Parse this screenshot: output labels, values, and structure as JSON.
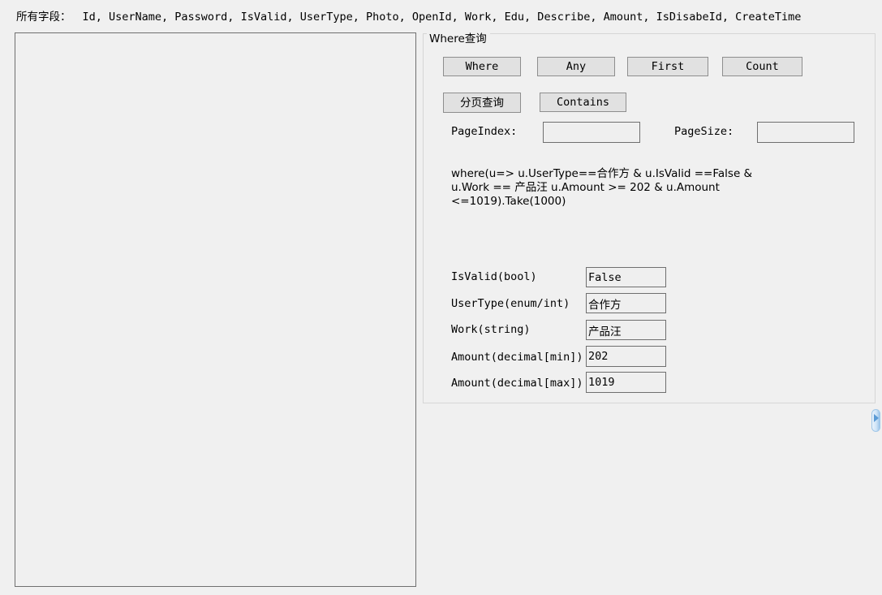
{
  "header": {
    "label": "所有字段：",
    "fields": "Id, UserName, Password, IsValid, UserType, Photo, OpenId, Work, Edu, Describe, Amount, IsDisabeId, CreateTime"
  },
  "results_panel": {
    "content": ""
  },
  "where_group": {
    "title": "Where查询",
    "buttons": {
      "where": "Where",
      "any": "Any",
      "first": "First",
      "count": "Count",
      "paging": "分页查询",
      "contains": "Contains"
    },
    "paging": {
      "page_index_label": "PageIndex:",
      "page_index_value": "",
      "page_size_label": "PageSize:",
      "page_size_value": ""
    },
    "expression": "where(u=> u.UserType==合作方 & u.IsValid ==False & u.Work == 产品汪 u.Amount >= 202 & u.Amount <=1019).Take(1000)",
    "form": {
      "isvalid_label": "IsValid(bool)",
      "isvalid_value": "False",
      "usertype_label": "UserType(enum/int)",
      "usertype_value": "合作方",
      "work_label": "Work(string)",
      "work_value": "产品汪",
      "amount_min_label": "Amount(decimal[min])",
      "amount_min_value": "202",
      "amount_max_label": "Amount(decimal[max])",
      "amount_max_value": "1019"
    }
  },
  "colors": {
    "window_background": "#f0f0f0",
    "panel_border": "#6f6f6f",
    "group_border": "#d6d6d6",
    "button_face": "#e1e1e1",
    "button_border": "#8e8e8e",
    "input_background": "#efefef",
    "scroll_accent": "#5b9bd5"
  }
}
